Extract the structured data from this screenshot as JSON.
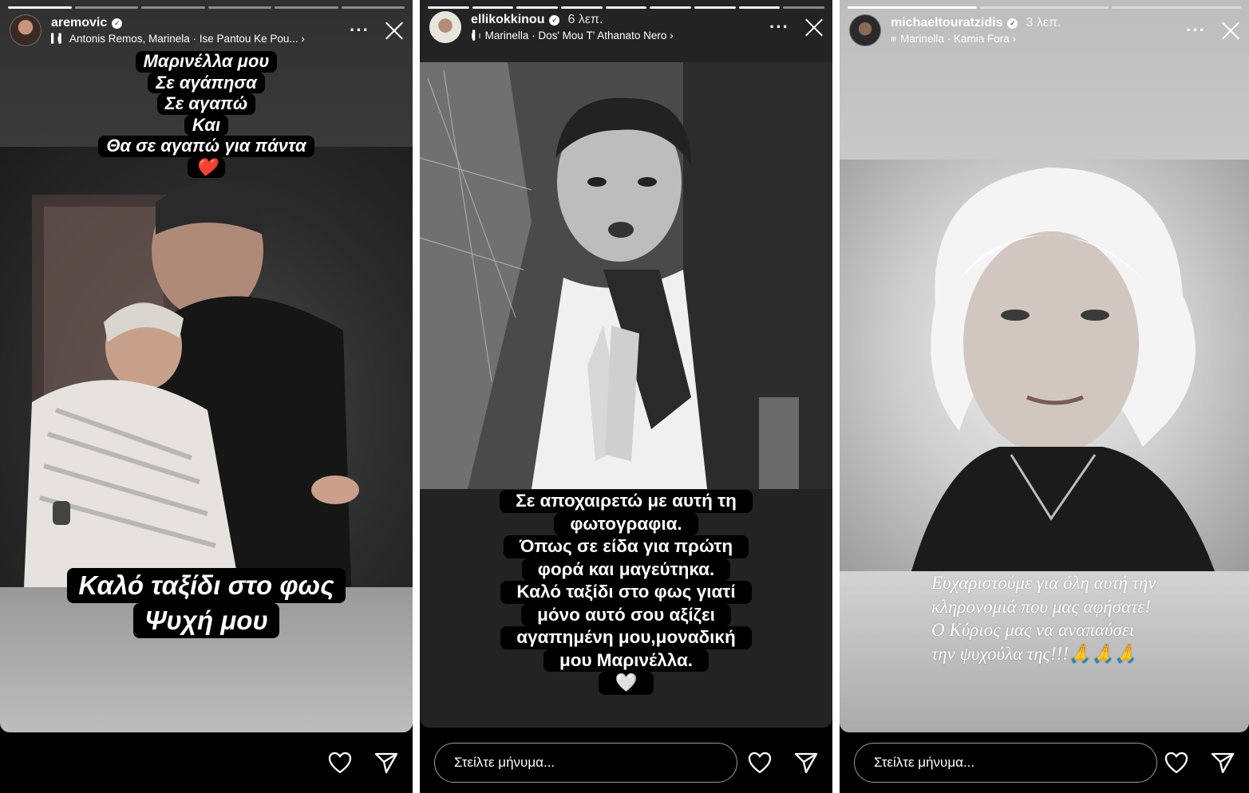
{
  "stories": [
    {
      "username": "aremovic",
      "time": "",
      "music": "Antonis Remos, Marinela · Ise Pantou Ke Pou... ›",
      "caption_top": [
        "Μαρινέλλα μου",
        "Σε αγάπησα",
        "Σε αγαπώ",
        "Και",
        "Θα σε αγαπώ για πάντα"
      ],
      "caption_top_emoji": "❤️",
      "caption_bottom": [
        "Καλό ταξίδι στο φως",
        "Ψυχή μου"
      ],
      "progress": {
        "segments": 6,
        "done": 1
      }
    },
    {
      "username": "ellikokkinou",
      "time": "6 λεπ.",
      "music": "Marinella · Dos' Mou T' Athanato Nero ›",
      "caption": [
        "Σε αποχαιρετώ με αυτή τη",
        "φωτογραφια.",
        "Όπως σε είδα για πρώτη",
        "φορά και μαγεύτηκα.",
        "Καλό ταξίδι στο φως γιατί",
        "μόνο αυτό σου αξίζει",
        "αγαπημένη μου,μοναδική",
        "μου Μαρινέλλα."
      ],
      "caption_emoji": "🤍",
      "message_placeholder": "Στείλτε μήνυμα...",
      "progress": {
        "segments": 9,
        "done": 8
      }
    },
    {
      "username": "michaeltouratzidis",
      "time": "3 λεπ.",
      "music": "Marinella · Kamia Fora ›",
      "caption": [
        "Ευχαριστούμε για όλη αυτή την",
        "κληρονομιά που μας αφήσατε!",
        "Ο Κύριος μας να αναπαύσει",
        "την ψυχούλα της!!!🙏🙏🙏"
      ],
      "message_placeholder": "Στείλτε μήνυμα...",
      "progress": {
        "segments": 3,
        "done": 1
      }
    }
  ],
  "icons": {
    "more": "more-icon",
    "close": "close-icon",
    "like": "heart-icon",
    "share": "send-icon",
    "music": "music-bars-icon",
    "verified": "verified-badge-icon"
  },
  "colors": {
    "background": "#000000",
    "text": "#ffffff",
    "caption_box": "#000000"
  }
}
